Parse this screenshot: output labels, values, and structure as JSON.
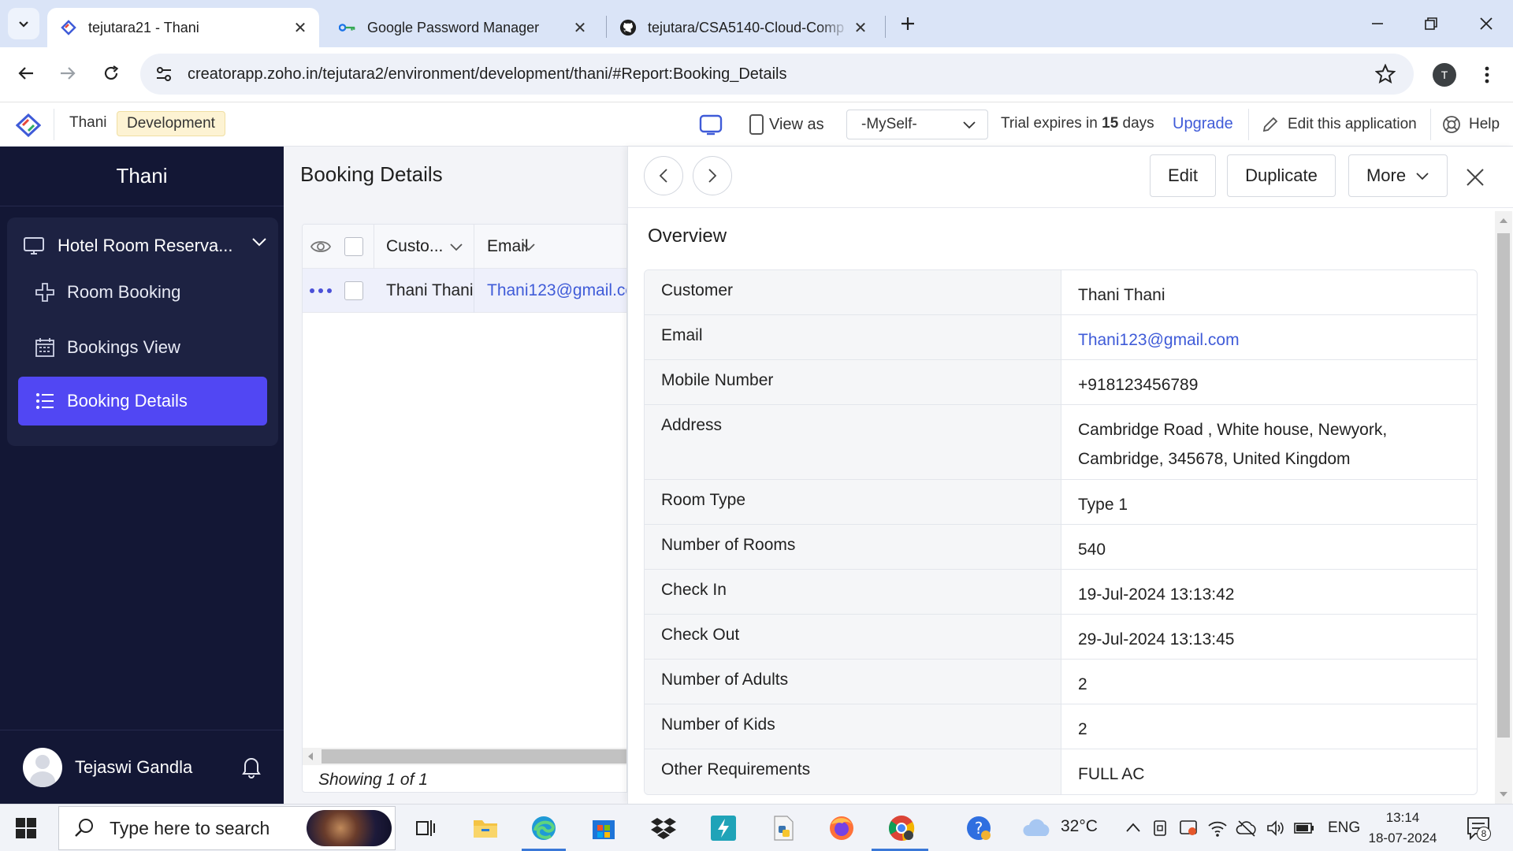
{
  "browser": {
    "tabs": [
      {
        "title": "tejutara21 - Thani",
        "active": true
      },
      {
        "title": "Google Password Manager",
        "active": false
      },
      {
        "title": "tejutara/CSA5140-Cloud-Comp",
        "active": false
      }
    ],
    "url": "creatorapp.zoho.in/tejutara2/environment/development/thani/#Report:Booking_Details",
    "profile_initial": "T"
  },
  "app_header": {
    "app_name": "Thani",
    "environment": "Development",
    "view_as_label": "View as",
    "view_as_value": "-MySelf-",
    "trial_prefix": "Trial expires in",
    "trial_days": "15",
    "trial_suffix": "days",
    "upgrade_label": "Upgrade",
    "edit_app_label": "Edit this application",
    "help_label": "Help"
  },
  "sidebar": {
    "title": "Thani",
    "group_label": "Hotel Room Reserva...",
    "items": [
      {
        "label": "Room Booking",
        "icon": "plus-icon",
        "active": false
      },
      {
        "label": "Bookings View",
        "icon": "calendar-icon",
        "active": false
      },
      {
        "label": "Booking Details",
        "icon": "list-icon",
        "active": true
      }
    ],
    "user_name": "Tejaswi Gandla"
  },
  "report": {
    "title": "Booking Details",
    "columns": [
      "Custo...",
      "Email"
    ],
    "rows": [
      {
        "customer": "Thani Thani",
        "email": "Thani123@gmail.com"
      }
    ],
    "footer": "Showing 1 of 1"
  },
  "detail": {
    "buttons": {
      "edit": "Edit",
      "duplicate": "Duplicate",
      "more": "More"
    },
    "section_title": "Overview",
    "fields": [
      {
        "label": "Customer",
        "value": "Thani Thani"
      },
      {
        "label": "Email",
        "value": "Thani123@gmail.com"
      },
      {
        "label": "Mobile Number",
        "value": "+918123456789"
      },
      {
        "label": "Address",
        "value": "Cambridge Road , White house, Newyork, Cambridge, 345678, United Kingdom"
      },
      {
        "label": "Room Type",
        "value": "Type 1"
      },
      {
        "label": "Number of Rooms",
        "value": "540"
      },
      {
        "label": "Check In",
        "value": "19-Jul-2024 13:13:42"
      },
      {
        "label": "Check Out",
        "value": "29-Jul-2024 13:13:45"
      },
      {
        "label": "Number of Adults",
        "value": "2"
      },
      {
        "label": "Number of Kids",
        "value": "2"
      },
      {
        "label": "Other Requirements",
        "value": "FULL AC"
      }
    ]
  },
  "taskbar": {
    "search_placeholder": "Type here to search",
    "temperature": "32°C",
    "language": "ENG",
    "time": "13:14",
    "date": "18-07-2024",
    "notification_count": "8"
  },
  "colors": {
    "sidebar_bg": "#131735",
    "sidebar_active": "#5147f3",
    "link": "#3f5bd8",
    "env_badge": "#fdf3d3",
    "tabstrip": "#dae4f7"
  }
}
